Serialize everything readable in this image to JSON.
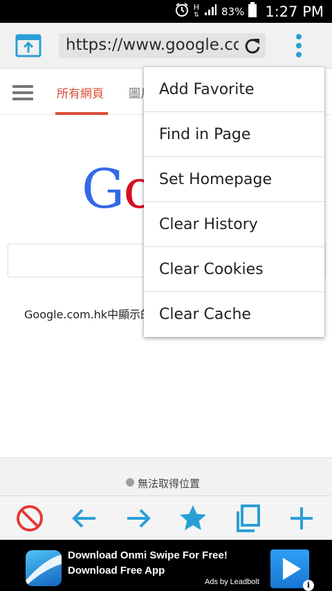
{
  "status_bar": {
    "network_type": "H",
    "battery_percent": "83%",
    "time": "1:27 PM",
    "icons": [
      "alarm-icon",
      "signal-icon",
      "battery-icon"
    ]
  },
  "toolbar": {
    "url": "https://www.google.com",
    "icons": [
      "tabs-icon",
      "reload-icon",
      "overflow-menu-icon"
    ],
    "accent_color": "#2a9fd6"
  },
  "page": {
    "nav": {
      "tab_all": "所有網頁",
      "tab_images": "圖片"
    },
    "logo_text": "Go",
    "offered_in": "Google.com.hk中顯示的語言"
  },
  "location": {
    "text": "無法取得位置"
  },
  "bottom_bar": {
    "buttons": [
      "block-icon",
      "back-arrow-icon",
      "forward-arrow-icon",
      "star-icon",
      "copy-icon",
      "add-icon"
    ],
    "colors": {
      "block": "#e53935",
      "accent": "#2a9fd6"
    }
  },
  "overflow_menu": {
    "items": [
      {
        "label": "Add Favorite"
      },
      {
        "label": "Find in Page"
      },
      {
        "label": "Set Homepage"
      },
      {
        "label": "Clear History"
      },
      {
        "label": "Clear Cookies"
      },
      {
        "label": "Clear Cache"
      }
    ]
  },
  "ad": {
    "title": "Download Onmi Swipe For Free!",
    "subtitle": "Download Free App",
    "attribution": "Ads by Leadbolt",
    "info_glyph": "i"
  }
}
